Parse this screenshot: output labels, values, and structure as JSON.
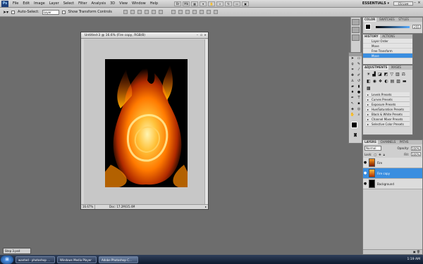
{
  "app": {
    "logo": "Ps",
    "menu": [
      "File",
      "Edit",
      "Image",
      "Layer",
      "Select",
      "Filter",
      "Analysis",
      "3D",
      "View",
      "Window",
      "Help"
    ],
    "workspace": "ESSENTIALS ▾",
    "cs_live": "CS Live"
  },
  "options_bar": {
    "auto_select_label": "Auto-Select:",
    "auto_select_value": "Layer",
    "show_transform_label": "Show Transform Controls"
  },
  "document": {
    "title": "Untitled-3 @ 16.6% (Fire copy, RGB/8)",
    "zoom": "16.67%",
    "doc_info": "Doc: 17.2M/35.4M"
  },
  "color_panel": {
    "tabs": [
      "COLOR",
      "SWATCHES",
      "STYLES"
    ],
    "value": "255"
  },
  "history_panel": {
    "tabs": [
      "HISTORY",
      "ACTIONS"
    ],
    "items": [
      "Layer Order",
      "Move",
      "Free Transform",
      "Move"
    ],
    "active_index": 3
  },
  "adjustments_panel": {
    "tabs": [
      "ADJUSTMENTS",
      "MASKS"
    ],
    "presets": [
      "Levels Presets",
      "Curves Presets",
      "Exposure Presets",
      "Hue/Saturation Presets",
      "Black & White Presets",
      "Channel Mixer Presets",
      "Selective Color Presets"
    ]
  },
  "layers_panel": {
    "tabs": [
      "LAYERS",
      "CHANNELS",
      "PATHS"
    ],
    "blend_mode": "Normal",
    "opacity_label": "Opacity:",
    "opacity": "100%",
    "lock_label": "Lock:",
    "fill_label": "Fill:",
    "fill": "100%",
    "layers": [
      {
        "name": "Fire",
        "active": false
      },
      {
        "name": "Fire copy",
        "active": true
      },
      {
        "name": "Background",
        "active": false
      }
    ]
  },
  "mini_window": {
    "label": "Step 3.psd"
  },
  "taskbar": {
    "tasks": [
      "wanted - photoshop ...",
      "Windows Media Player",
      "Adobe Photoshop C..."
    ],
    "time": "1:19 AM"
  },
  "colors": {
    "accent": "#3a8ee0",
    "fire": "#ff8a00"
  }
}
